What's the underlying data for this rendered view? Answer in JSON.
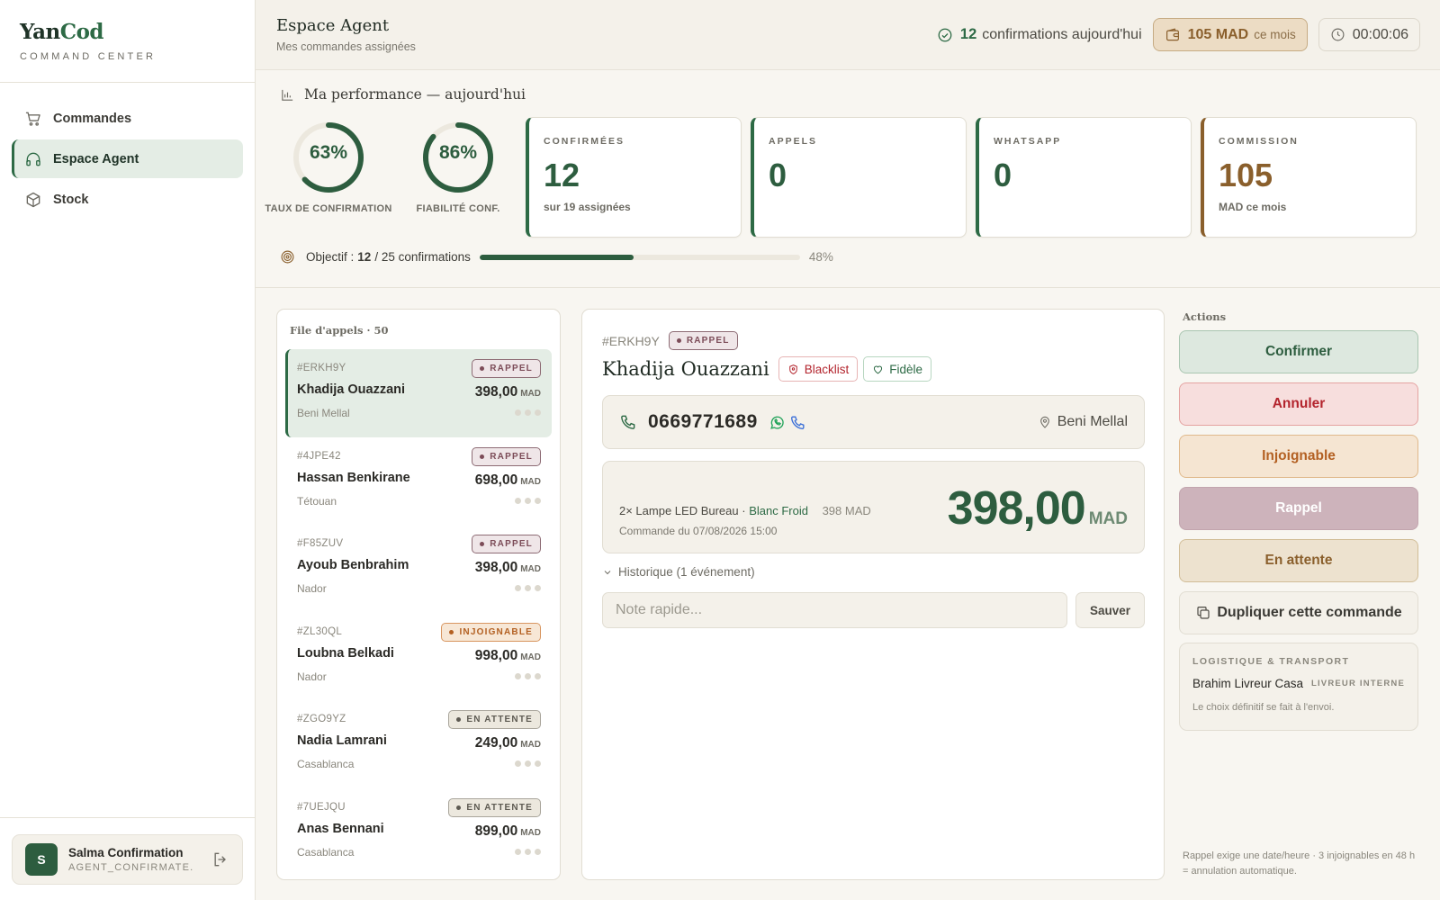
{
  "brand": {
    "name_part1": "Yan",
    "name_part2": "Cod",
    "subtitle": "COMMAND CENTER"
  },
  "sidebar": {
    "items": [
      {
        "label": "Commandes",
        "icon": "cart-icon",
        "active": false
      },
      {
        "label": "Espace Agent",
        "icon": "headset-icon",
        "active": true
      },
      {
        "label": "Stock",
        "icon": "box-icon",
        "active": false
      }
    ],
    "user": {
      "initial": "S",
      "name": "Salma Confirmation",
      "role": "AGENT_CONFIRMATE..."
    }
  },
  "header": {
    "title": "Espace Agent",
    "subtitle": "Mes commandes assignées",
    "confirmations_count": "12",
    "confirmations_label": "confirmations aujourd'hui",
    "earnings_value": "105 MAD",
    "earnings_suffix": "ce mois",
    "timer": "00:00:06"
  },
  "performance": {
    "title": "Ma performance — aujourd'hui",
    "gauges": [
      {
        "value": 63,
        "label_pct": "63%",
        "label": "TAUX DE CONFIRMATION"
      },
      {
        "value": 86,
        "label_pct": "86%",
        "label": "FIABILITÉ CONF."
      }
    ],
    "stats": [
      {
        "label": "CONFIRMÉES",
        "value": "12",
        "sub": "sur 19 assignées",
        "accent": "#2d6a45"
      },
      {
        "label": "APPELS",
        "value": "0",
        "sub": "",
        "accent": "#2d6a45"
      },
      {
        "label": "WHATSAPP",
        "value": "0",
        "sub": "",
        "accent": "#2d6a45"
      },
      {
        "label": "COMMISSION",
        "value": "105",
        "sub": "MAD ce mois",
        "accent": "#8a5f2c"
      }
    ],
    "objective": {
      "prefix": "Objectif :",
      "done": "12",
      "rest": "/ 25 confirmations",
      "progress": 0.48,
      "pct_label": "48%"
    }
  },
  "queue": {
    "title": "File d'appels · 50",
    "items": [
      {
        "id": "#ERKH9Y",
        "name": "Khadija Ouazzani",
        "city": "Beni Mellal",
        "price": "398,00",
        "currency": "MAD",
        "status": "RAPPEL",
        "status_kind": "rappel",
        "active": true
      },
      {
        "id": "#4JPE42",
        "name": "Hassan Benkirane",
        "city": "Tétouan",
        "price": "698,00",
        "currency": "MAD",
        "status": "RAPPEL",
        "status_kind": "rappel",
        "active": false
      },
      {
        "id": "#F85ZUV",
        "name": "Ayoub Benbrahim",
        "city": "Nador",
        "price": "398,00",
        "currency": "MAD",
        "status": "RAPPEL",
        "status_kind": "rappel",
        "active": false
      },
      {
        "id": "#ZL30QL",
        "name": "Loubna Belkadi",
        "city": "Nador",
        "price": "998,00",
        "currency": "MAD",
        "status": "INJOIGNABLE",
        "status_kind": "injo",
        "active": false
      },
      {
        "id": "#ZGO9YZ",
        "name": "Nadia Lamrani",
        "city": "Casablanca",
        "price": "249,00",
        "currency": "MAD",
        "status": "EN ATTENTE",
        "status_kind": "attente",
        "active": false
      },
      {
        "id": "#7UEJQU",
        "name": "Anas Bennani",
        "city": "Casablanca",
        "price": "899,00",
        "currency": "MAD",
        "status": "EN ATTENTE",
        "status_kind": "attente",
        "active": false
      }
    ]
  },
  "detail": {
    "id": "#ERKH9Y",
    "status": "RAPPEL",
    "name": "Khadija Ouazzani",
    "tag_blacklist": "Blacklist",
    "tag_fidele": "Fidèle",
    "phone": "0669771689",
    "city": "Beni Mellal",
    "order_line": "2× Lampe LED Bureau ·",
    "order_variant": "Blanc Froid",
    "order_line_price": "398 MAD",
    "order_date": "Commande du 07/08/2026 15:00",
    "total": "398,00",
    "currency": "MAD",
    "history": "Historique (1 événement)",
    "note_placeholder": "Note rapide...",
    "save_label": "Sauver"
  },
  "actions": {
    "title": "Actions",
    "confirm": "Confirmer",
    "cancel": "Annuler",
    "unreachable": "Injoignable",
    "callback": "Rappel",
    "pending": "En attente",
    "duplicate": "Dupliquer cette commande",
    "logistics": {
      "title": "LOGISTIQUE & TRANSPORT",
      "driver": "Brahim Livreur Casa",
      "type": "LIVREUR INTERNE",
      "note": "Le choix définitif se fait à l'envoi."
    },
    "footnote": "Rappel exige une date/heure · 3 injoignables en 48 h = annulation automatique."
  }
}
